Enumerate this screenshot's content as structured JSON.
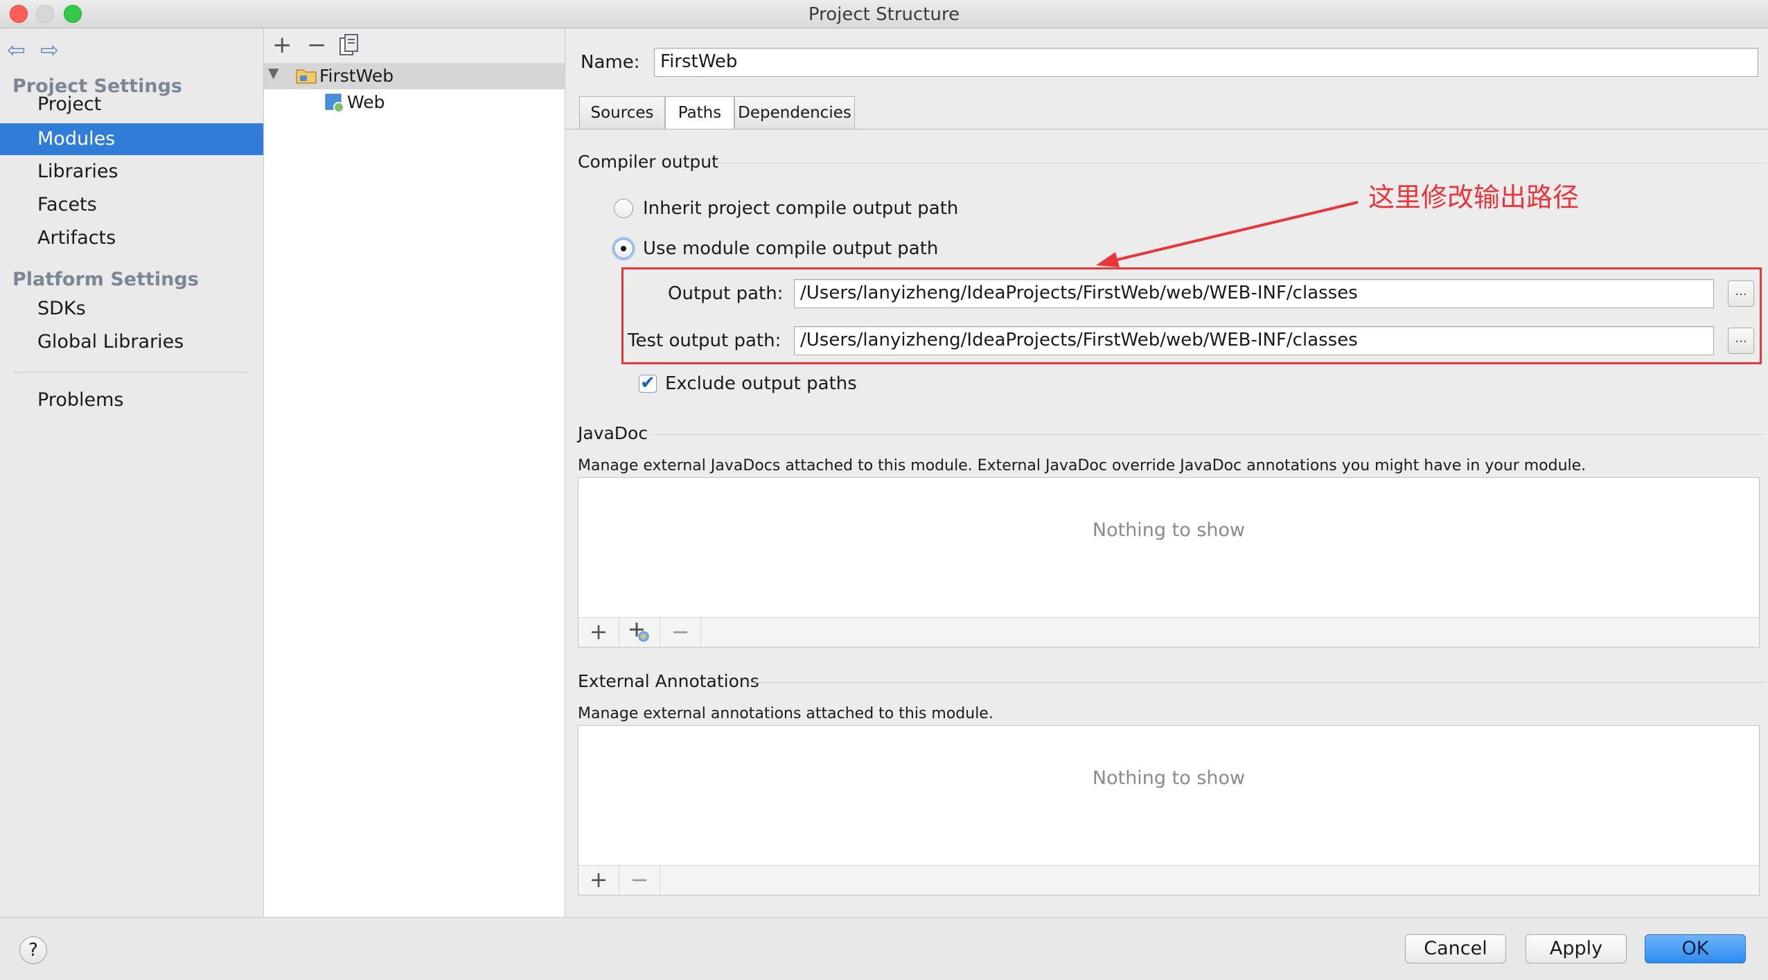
{
  "window": {
    "title": "Project Structure"
  },
  "nav": {
    "back_icon": "arrow-left-icon",
    "forward_icon": "arrow-right-icon",
    "project_settings_header": "Project Settings",
    "project_settings_items": [
      "Project",
      "Modules",
      "Libraries",
      "Facets",
      "Artifacts"
    ],
    "platform_settings_header": "Platform Settings",
    "platform_settings_items": [
      "SDKs",
      "Global Libraries"
    ],
    "problems": "Problems",
    "selected": "Modules"
  },
  "tree": {
    "toolbar": {
      "add": "+",
      "remove": "−"
    },
    "root": "FirstWeb",
    "child": "Web"
  },
  "module": {
    "name_label": "Name:",
    "name_value": "FirstWeb",
    "tabs": [
      "Sources",
      "Paths",
      "Dependencies"
    ],
    "active_tab": "Paths"
  },
  "compiler_output": {
    "title": "Compiler output",
    "inherit_option": "Inherit project compile output path",
    "module_option": "Use module compile output path",
    "selected_option": "module",
    "output_label": "Output path:",
    "output_value": "/Users/lanyizheng/IdeaProjects/FirstWeb/web/WEB-INF/classes",
    "test_output_label": "Test output path:",
    "test_output_value": "/Users/lanyizheng/IdeaProjects/FirstWeb/web/WEB-INF/classes",
    "browse": "...",
    "exclude_label": "Exclude output paths",
    "exclude_checked": true
  },
  "javadoc": {
    "title": "JavaDoc",
    "description": "Manage external JavaDocs attached to this module. External JavaDoc override JavaDoc annotations you might have in your module.",
    "empty": "Nothing to show",
    "toolbar": {
      "add": "+",
      "remove": "−"
    }
  },
  "external_annotations": {
    "title": "External Annotations",
    "description": "Manage external annotations attached to this module.",
    "empty": "Nothing to show",
    "toolbar": {
      "add": "+",
      "remove": "−"
    }
  },
  "annotation": {
    "text": "这里修改输出路径",
    "color": "#e8363a"
  },
  "footer": {
    "help": "?",
    "cancel": "Cancel",
    "apply": "Apply",
    "ok": "OK"
  }
}
